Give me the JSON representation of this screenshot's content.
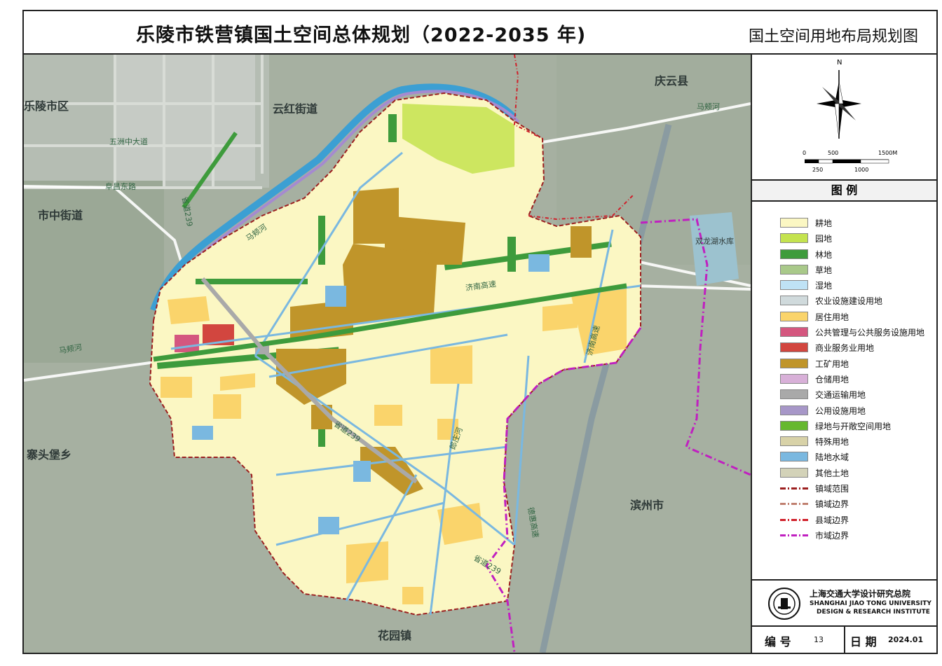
{
  "header": {
    "title": "乐陵市铁营镇国土空间总体规划（2022-2035 年)",
    "subtitle": "国土空间用地布局规划图"
  },
  "map": {
    "places": {
      "leling_district": "乐陵市区",
      "yunhong_street": "云红街道",
      "qingyun_county": "庆云县",
      "shizhong_street": "市中街道",
      "zhaitoubao": "寨头堡乡",
      "binzhou": "滨州市",
      "huayuan": "花园镇",
      "shuanglonghu": "双龙湖水库"
    },
    "roads": {
      "wuzhou": "五洲中大道",
      "fuchang": "阜昌东路",
      "s239_west": "省道239",
      "majia_river_north": "马颊河",
      "majia_river_west": "马颊河",
      "s239_center": "省道239",
      "chenzhuang_river": "郎庄河",
      "s239_south": "省道239",
      "expressway_center": "济南高速",
      "expressway_east": "济南高速",
      "expressway_south": "德惠高速",
      "majia_east": "马颊河"
    }
  },
  "compass": {
    "north_label": "N",
    "scale_top": [
      "0",
      "500",
      "1500M"
    ],
    "scale_bottom": [
      "250",
      "1000"
    ]
  },
  "legend": {
    "title": "图 例",
    "items": [
      {
        "label": "耕地",
        "color": "#fbf7c3",
        "kind": "fill"
      },
      {
        "label": "园地",
        "color": "#c4e34f",
        "kind": "fill"
      },
      {
        "label": "林地",
        "color": "#3e9b3c",
        "kind": "fill"
      },
      {
        "label": "草地",
        "color": "#a9c98a",
        "kind": "fill"
      },
      {
        "label": "湿地",
        "color": "#bfe2f5",
        "kind": "fill"
      },
      {
        "label": "农业设施建设用地",
        "color": "#d0dadc",
        "kind": "fill"
      },
      {
        "label": "居住用地",
        "color": "#fad46b",
        "kind": "fill"
      },
      {
        "label": "公共管理与公共服务设施用地",
        "color": "#d4577f",
        "kind": "fill"
      },
      {
        "label": "商业服务业用地",
        "color": "#d2463f",
        "kind": "fill"
      },
      {
        "label": "工矿用地",
        "color": "#c0952a",
        "kind": "fill"
      },
      {
        "label": "仓储用地",
        "color": "#d8b0d8",
        "kind": "fill"
      },
      {
        "label": "交通运输用地",
        "color": "#a9a9a9",
        "kind": "fill"
      },
      {
        "label": "公用设施用地",
        "color": "#a797c8",
        "kind": "fill"
      },
      {
        "label": "绿地与开敞空间用地",
        "color": "#66b82f",
        "kind": "fill"
      },
      {
        "label": "特殊用地",
        "color": "#d8d2a8",
        "kind": "fill"
      },
      {
        "label": "陆地水域",
        "color": "#7ab8e0",
        "kind": "fill"
      },
      {
        "label": "其他土地",
        "color": "#d3d2b8",
        "kind": "fill"
      },
      {
        "label": "镇域范围",
        "color": "#9c1f1f",
        "kind": "line"
      },
      {
        "label": "镇域边界",
        "color": "#c08070",
        "kind": "line"
      },
      {
        "label": "县域边界",
        "color": "#d0202a",
        "kind": "line"
      },
      {
        "label": "市域边界",
        "color": "#c020c0",
        "kind": "line"
      }
    ]
  },
  "institute": {
    "name_cn": "上海交通大学设计研究总院",
    "name_en1": "SHANGHAI JIAO TONG UNIVERSITY",
    "name_en2": "DESIGN & RESEARCH INSTITUTE"
  },
  "footer": {
    "number_label": "编 号",
    "number_value": "13",
    "date_label": "日 期",
    "date_value": "2024.01"
  }
}
